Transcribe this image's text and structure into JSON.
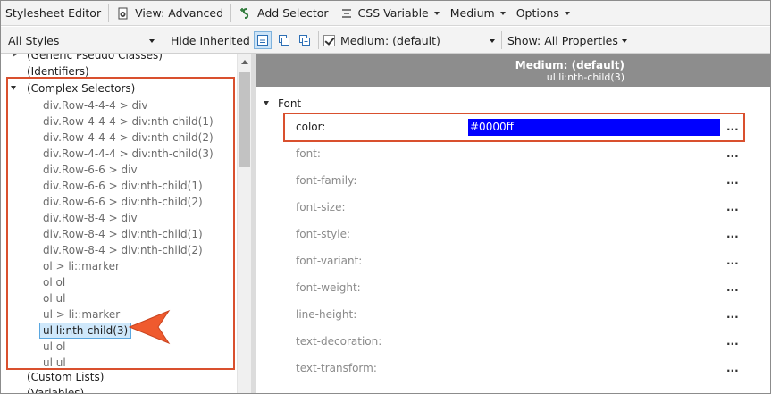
{
  "toolbar": {
    "title": "Stylesheet Editor",
    "view_label": "View: Advanced",
    "add_selector_label": "Add Selector",
    "css_variable_label": "CSS Variable",
    "medium_label": "Medium",
    "options_label": "Options"
  },
  "filter_bar": {
    "styles_filter": "All Styles",
    "hide_inherited": "Hide Inherited",
    "medium_selected": "Medium: (default)",
    "show_properties": "Show: All Properties"
  },
  "tree": {
    "partial_top": "(Generic Pseudo Classes)",
    "identifiers": "(Identifiers)",
    "complex_selectors": "(Complex Selectors)",
    "children": [
      "div.Row-4-4-4 > div",
      "div.Row-4-4-4 > div:nth-child(1)",
      "div.Row-4-4-4 > div:nth-child(2)",
      "div.Row-4-4-4 > div:nth-child(3)",
      "div.Row-6-6 > div",
      "div.Row-6-6 > div:nth-child(1)",
      "div.Row-6-6 > div:nth-child(2)",
      "div.Row-8-4 > div",
      "div.Row-8-4 > div:nth-child(1)",
      "div.Row-8-4 > div:nth-child(2)",
      "ol > li::marker",
      "ol ol",
      "ol ul",
      "ul > li::marker",
      "ul li:nth-child(3)",
      "ul ol",
      "ul ul"
    ],
    "custom_lists": "(Custom Lists)",
    "variables": "(Variables)"
  },
  "properties": {
    "header_medium": "Medium: (default)",
    "header_selector": "ul li:nth-child(3)",
    "category": "Font",
    "rows": [
      {
        "name": "color:",
        "value": "#0000ff"
      },
      {
        "name": "font:",
        "value": ""
      },
      {
        "name": "font-family:",
        "value": ""
      },
      {
        "name": "font-size:",
        "value": ""
      },
      {
        "name": "font-style:",
        "value": ""
      },
      {
        "name": "font-variant:",
        "value": ""
      },
      {
        "name": "font-weight:",
        "value": ""
      },
      {
        "name": "line-height:",
        "value": ""
      },
      {
        "name": "text-decoration:",
        "value": ""
      },
      {
        "name": "text-transform:",
        "value": ""
      }
    ],
    "ellipsis": "..."
  },
  "colors": {
    "color_value_swatch": "#0000ff",
    "annotation": "#d9502e",
    "selection": "#cfe8fb"
  }
}
